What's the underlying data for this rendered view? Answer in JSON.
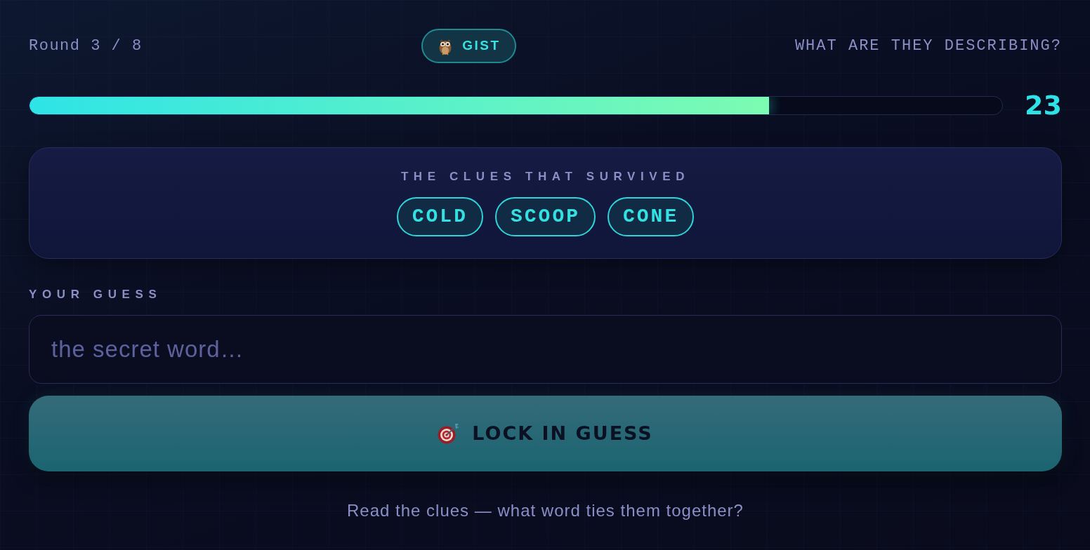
{
  "header": {
    "round": "Round 3 / 8",
    "mode_badge": "GIST",
    "prompt": "WHAT ARE THEY DESCRIBING?"
  },
  "timer": {
    "level": 0.76,
    "reading": "23"
  },
  "clues": {
    "title": "THE CLUES THAT SURVIVED",
    "items": [
      "COLD",
      "SCOOP",
      "CONE"
    ]
  },
  "guess": {
    "label": "YOUR GUESS",
    "placeholder": "the secret word…"
  },
  "submit_button": {
    "label": "LOCK IN GUESS"
  },
  "hint": "Read the clues — what word ties them together?"
}
